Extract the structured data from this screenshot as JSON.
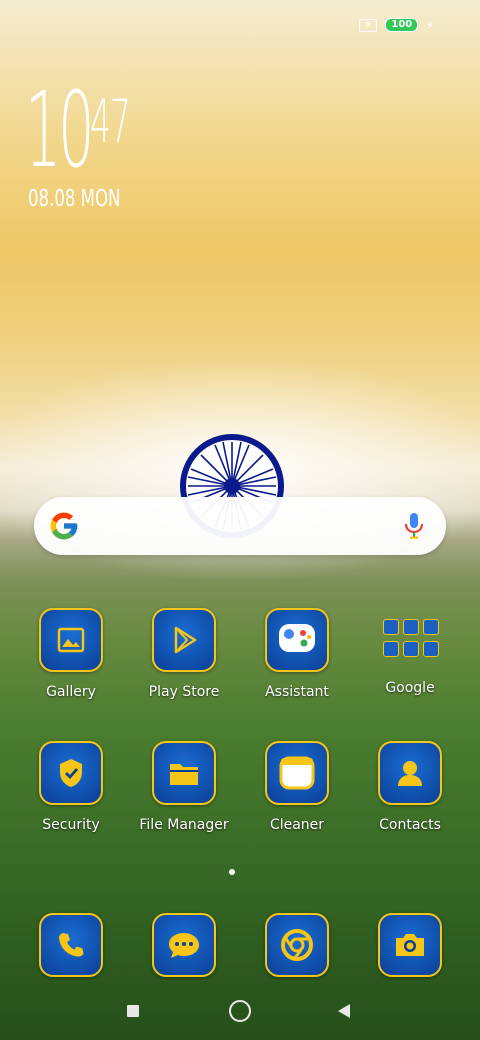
{
  "status": {
    "battery": "100",
    "charging_icon": "bolt-icon",
    "sim_icon": "no-sim-icon"
  },
  "clock": {
    "hour": "10",
    "minute": "47",
    "date": "08.08 MON"
  },
  "search": {
    "logo": "google-g-icon",
    "mic": "microphone-icon"
  },
  "apps": {
    "row1": [
      {
        "label": "Gallery",
        "icon": "gallery-icon"
      },
      {
        "label": "Play Store",
        "icon": "play-store-icon"
      },
      {
        "label": "Assistant",
        "icon": "assistant-icon"
      },
      {
        "label": "Google",
        "icon": "folder-icon"
      }
    ],
    "row2": [
      {
        "label": "Security",
        "icon": "shield-check-icon"
      },
      {
        "label": "File Manager",
        "icon": "folder-icon"
      },
      {
        "label": "Cleaner",
        "icon": "cleaner-icon"
      },
      {
        "label": "Contacts",
        "icon": "person-icon"
      }
    ],
    "dock": [
      {
        "icon": "phone-icon"
      },
      {
        "icon": "message-icon"
      },
      {
        "icon": "chrome-icon"
      },
      {
        "icon": "camera-icon"
      }
    ]
  },
  "colors": {
    "tile": "#0a3f96",
    "border": "#f5c518"
  }
}
